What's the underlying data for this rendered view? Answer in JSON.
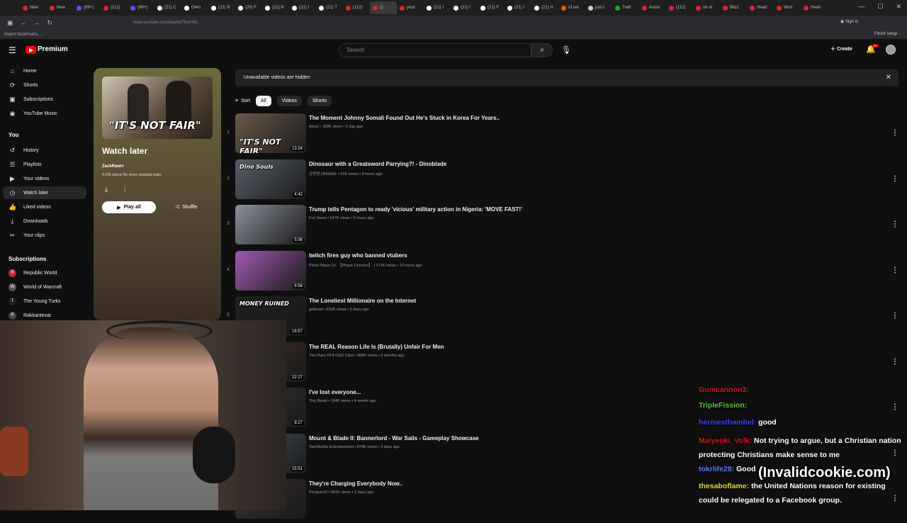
{
  "browser": {
    "tabs": [
      {
        "label": "New",
        "color": "#d23"
      },
      {
        "label": "New",
        "color": "#d23"
      },
      {
        "label": "(99+)",
        "color": "#55f"
      },
      {
        "label": "(112)",
        "color": "#d23"
      },
      {
        "label": "(99+)",
        "color": "#55f"
      },
      {
        "label": "(21) C",
        "color": "#fff"
      },
      {
        "label": "G4m",
        "color": "#fff"
      },
      {
        "label": "(21) B",
        "color": "#fff"
      },
      {
        "label": "(20) F",
        "color": "#fff"
      },
      {
        "label": "(21) N",
        "color": "#fff"
      },
      {
        "label": "(21) I",
        "color": "#fff"
      },
      {
        "label": "(21) T",
        "color": "#fff"
      },
      {
        "label": "(112)",
        "color": "#d23"
      },
      {
        "label": "(1",
        "color": "#d23",
        "active": true
      },
      {
        "label": "yout",
        "color": "#d23"
      },
      {
        "label": "(21) I",
        "color": "#fff"
      },
      {
        "label": "(21) I",
        "color": "#fff"
      },
      {
        "label": "(21) F",
        "color": "#fff"
      },
      {
        "label": "(21) I",
        "color": "#fff"
      },
      {
        "label": "(21) H",
        "color": "#fff"
      },
      {
        "label": "r/Live",
        "color": "#f50"
      },
      {
        "label": "just c",
        "color": "#ccc"
      },
      {
        "label": "Twitt",
        "color": "#2a2"
      },
      {
        "label": "Asmo",
        "color": "#d23"
      },
      {
        "label": "(112)",
        "color": "#d23"
      },
      {
        "label": "Im al",
        "color": "#d23"
      },
      {
        "label": "Blizz",
        "color": "#d23"
      },
      {
        "label": "Heart",
        "color": "#d23"
      },
      {
        "label": "Worl",
        "color": "#d23"
      },
      {
        "label": "Heart",
        "color": "#d23"
      }
    ],
    "url": "www.youtube.com/playlist?list=WL",
    "bookmark": "Import bookmarks...",
    "signin": "Sign in",
    "finish_setup": "Finish setup"
  },
  "header": {
    "brand": "Premium",
    "search_placeholder": "Search",
    "create_label": "Create",
    "notif_count": "9+"
  },
  "sidebar": {
    "main": [
      {
        "label": "Home",
        "icon": "⌂"
      },
      {
        "label": "Shorts",
        "icon": "⟳"
      },
      {
        "label": "Subscriptions",
        "icon": "▣"
      },
      {
        "label": "YouTube Music",
        "icon": "◉"
      }
    ],
    "you_heading": "You",
    "you_items": [
      {
        "label": "History",
        "icon": "↺"
      },
      {
        "label": "Playlists",
        "icon": "☰"
      },
      {
        "label": "Your videos",
        "icon": "▶"
      },
      {
        "label": "Watch later",
        "icon": "◷",
        "active": true
      },
      {
        "label": "Liked videos",
        "icon": "👍"
      },
      {
        "label": "Downloads",
        "icon": "⤓"
      },
      {
        "label": "Your clips",
        "icon": "✂"
      }
    ],
    "subs_heading": "Subscriptions",
    "subs": [
      {
        "label": "Republic World",
        "color": "#c0282e",
        "letter": "R"
      },
      {
        "label": "World of Warcraft",
        "color": "#555",
        "letter": "W"
      },
      {
        "label": "The Young Turks",
        "color": "#222",
        "letter": "T"
      },
      {
        "label": "Rakkantexar",
        "color": "#444",
        "letter": "R"
      }
    ]
  },
  "playlist": {
    "title": "Watch later",
    "owner": "ZackRawrr",
    "stats": "4,930 videos  No views  Updated today",
    "thumb_caption": "\"IT'S NOT FAIR\"",
    "play_all": "Play all",
    "shuffle": "Shuffle"
  },
  "main": {
    "banner": "Unavailable videos are hidden",
    "sort_label": "Sort",
    "chips": [
      "All",
      "Videos",
      "Shorts"
    ],
    "videos": [
      {
        "num": "1",
        "title": "The Moment Johnny Somali Found Out He's Stuck in Korea For Years..",
        "meta": "Atozy • 189K views • 1 day ago",
        "duration": "13:24",
        "caption": "\"IT'S NOT FAIR\"",
        "bg": "#6a5a48"
      },
      {
        "num": "2",
        "title": "Dinosaur with a Greatsword Parrying?! - Dinoblade",
        "meta": "긍정맨 ONGBAL • 41K views • 9 hours ago",
        "duration": "4:42",
        "caption": "Dino Souls",
        "bg": "#5a6068"
      },
      {
        "num": "3",
        "title": "Trump tells Pentagon to ready 'vicious' military action in Nigeria: 'MOVE FAST!'",
        "meta": "Fox News • 547K views • 5 hours ago",
        "duration": "5:56",
        "caption": "",
        "bg": "#8a8f99"
      },
      {
        "num": "4",
        "title": "twitch fires guy who banned vtubers",
        "meta": "Pirkin Pippa Ch. 【Phase Connect】 • 171K views • 22 hours ago",
        "duration": "6:56",
        "caption": "",
        "bg": "#a05ab0"
      },
      {
        "num": "5",
        "title": "The Loneliest Millionaire on the Internet",
        "meta": "goldcart • 332K views • 2 days ago",
        "duration": "16:57",
        "caption": "MONEY RUINED",
        "bg": "#1e1e1e"
      },
      {
        "num": "6",
        "title": "The REAL Reason Life Is (Brutally) Unfair For Men",
        "meta": "The Diary Of A CEO Clips • 589K views • 3 months ago",
        "duration": "22:27",
        "caption": "",
        "bg": "#40302a"
      },
      {
        "num": "7",
        "title": "I've lost everyone...",
        "meta": "Tiny Beast • 164K views • 4 weeks ago",
        "duration": "8:27",
        "caption": "",
        "bg": "#3a3530"
      },
      {
        "num": "8",
        "title": "Mount & Blade II: Bannerlord - War Sails - Gameplay Showcase",
        "meta": "TaleWorlds Entertainment • 878K views • 3 days ago",
        "duration": "15:51",
        "caption": "",
        "bg": "#4a5258"
      },
      {
        "num": "9",
        "title": "They're Charging Everybody Now..",
        "meta": "Penguinz0 • 891K views • 2 days ago",
        "duration": "",
        "caption": "",
        "bg": "#3a3030"
      }
    ]
  },
  "chat": [
    {
      "user": "Gumcannon3:",
      "user_color": "#cc1a1a",
      "text": ""
    },
    {
      "user": "TripleFission:",
      "user_color": "#5fbf3a",
      "text": ""
    },
    {
      "user": "hermesthambel:",
      "user_color": "#3344ff",
      "text": "good"
    },
    {
      "user": "Malyenki_Volk:",
      "user_color": "#cc1a1a",
      "text": "Not trying to argue, but a Christian nation protecting Christians make sense to me"
    },
    {
      "user": "tokrlife28:",
      "user_color": "#5a7bff",
      "text": "Good"
    },
    {
      "user": "thesaboflame:",
      "user_color": "#e8d34a",
      "text": "the United Nations reason for existing could be relegated to a Facebook group."
    }
  ],
  "watermark": "(Invalidcookie.com)"
}
